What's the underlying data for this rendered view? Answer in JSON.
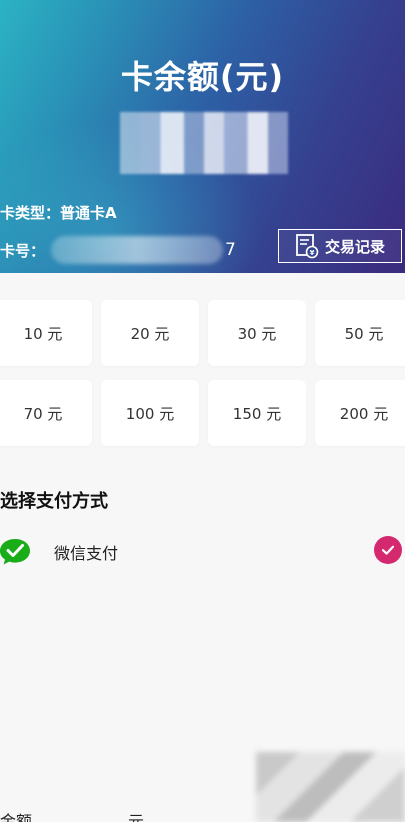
{
  "header": {
    "balance_title": "卡余额(元)",
    "balance_value": "",
    "card_type_label": "卡类型：普通卡A",
    "card_number_label": "卡号：",
    "card_number_tail": "7",
    "transaction_button_label": "交易记录"
  },
  "amounts": [
    {
      "label": "10 元"
    },
    {
      "label": "20 元"
    },
    {
      "label": "30 元"
    },
    {
      "label": "50 元"
    },
    {
      "label": "70 元"
    },
    {
      "label": "100 元"
    },
    {
      "label": "150 元"
    },
    {
      "label": "200 元"
    }
  ],
  "payment": {
    "section_title": "选择支付方式",
    "method_label": "微信支付",
    "method_icon": "wechat-pay-icon",
    "selected_icon": "check-circle-icon"
  },
  "footer": {
    "total_label": "金额",
    "unit_label": "元"
  },
  "colors": {
    "accent": "#d4286f",
    "wechat_green": "#1aad19"
  }
}
